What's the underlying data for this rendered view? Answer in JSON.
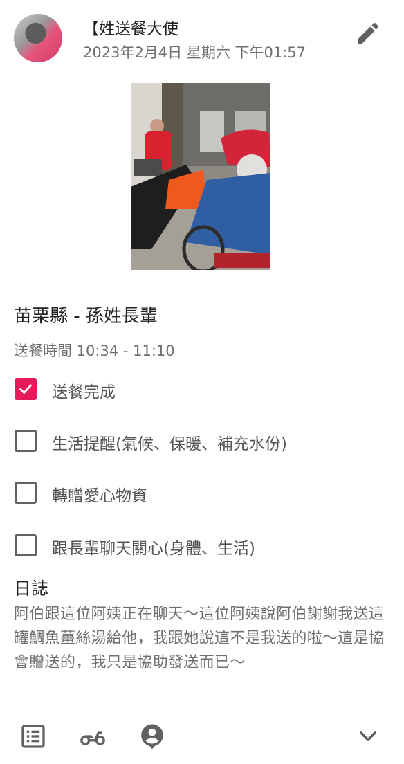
{
  "post": {
    "author": "【姓送餐大使",
    "timestamp": "2023年2月4日 星期六 下午01:57"
  },
  "title": "苗栗縣 - 孫姓長輩",
  "delivery_time": "送餐時間 10:34 - 11:10",
  "checklist": [
    {
      "label": "送餐完成",
      "checked": true
    },
    {
      "label": "生活提醒(氣候、保暖、補充水份)",
      "checked": false
    },
    {
      "label": "轉贈愛心物資",
      "checked": false
    },
    {
      "label": "跟長輩聊天關心(身體、生活)",
      "checked": false
    }
  ],
  "log": {
    "heading": "日誌",
    "text": "阿伯跟這位阿姨正在聊天～這位阿姨說阿伯謝謝我送這罐鯛魚薑絲湯給他，我跟她說這不是我送的啦～這是協會贈送的，我只是協助發送而已～"
  },
  "colors": {
    "accent": "#e6195a",
    "icon": "#616161",
    "secondary_text": "#6f6f6f"
  },
  "icons": {
    "edit": "pencil-icon",
    "list": "list-icon",
    "scooter": "scooter-icon",
    "person": "person-pin-icon",
    "expand": "chevron-down-icon"
  }
}
